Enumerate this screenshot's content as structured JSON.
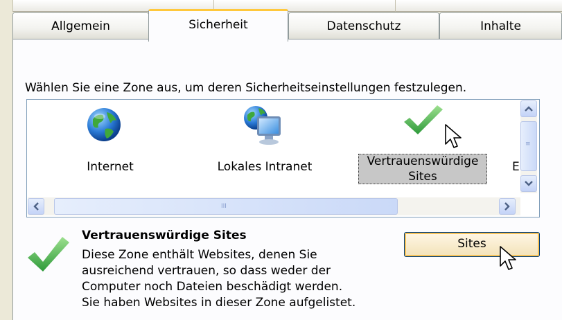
{
  "tabs": [
    {
      "label": "Allgemein"
    },
    {
      "label": "Sicherheit"
    },
    {
      "label": "Datenschutz"
    },
    {
      "label": "Inhalte"
    }
  ],
  "active_tab": "Sicherheit",
  "instruction": "Wählen Sie eine Zone aus, um deren Sicherheitseinstellungen festzulegen.",
  "zones": [
    {
      "label": "Internet",
      "icon": "globe-icon"
    },
    {
      "label": "Lokales Intranet",
      "icon": "intranet-computer-icon"
    },
    {
      "label_line1": "Vertrauenswürdige",
      "label_line2": "Sites",
      "icon": "checkmark-icon",
      "selected": true
    },
    {
      "label": "E",
      "icon": "restricted-sites-icon"
    }
  ],
  "scrollbars": {
    "h_grip": "III",
    "v_grip": "≡"
  },
  "description": {
    "title": "Vertrauenswürdige Sites",
    "lines": [
      "Diese Zone enthält Websites, denen Sie",
      "ausreichend vertrauen, so dass weder der",
      "Computer noch Dateien beschädigt werden.",
      "Sie haben Websites in dieser Zone aufgelistet."
    ]
  },
  "sites_button": "Sites",
  "colors": {
    "accent_tab": "#ffc83c",
    "check_green": "#4caf50",
    "list_border": "#7f9db9"
  }
}
